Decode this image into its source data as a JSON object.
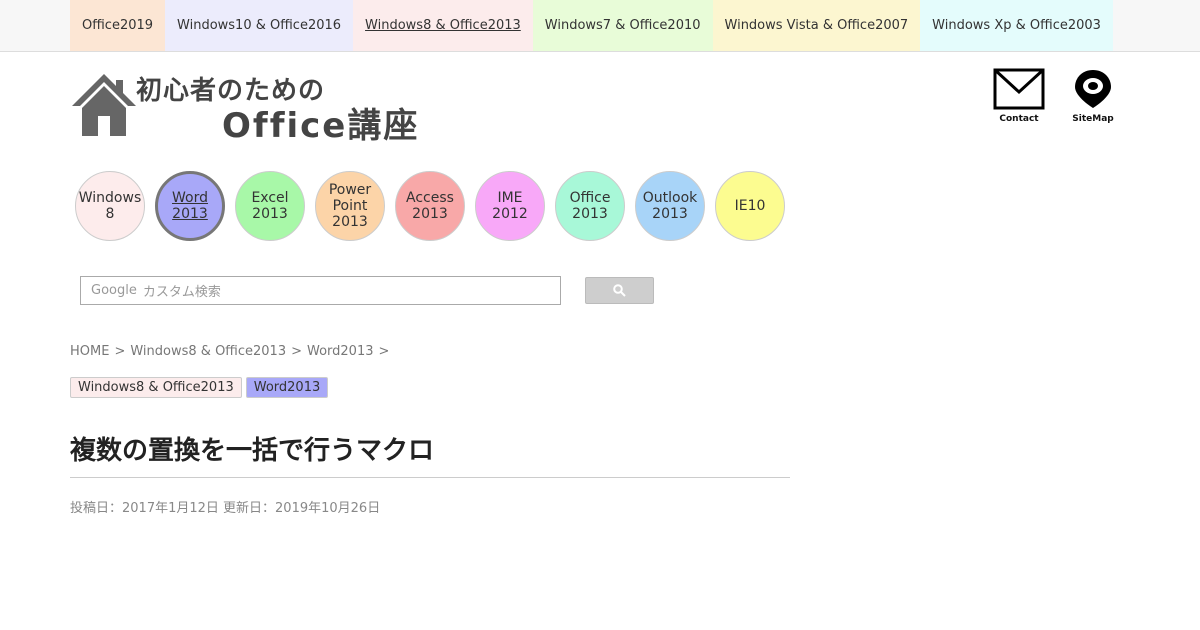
{
  "topnav": {
    "items": [
      {
        "label": "Office2019",
        "color": "#fce6d4",
        "active": false
      },
      {
        "label": "Windows10 & Office2016",
        "color": "#ececfc",
        "active": false
      },
      {
        "label": "Windows8 & Office2013",
        "color": "#fcecec",
        "active": true
      },
      {
        "label": "Windows7 & Office2010",
        "color": "#e8fcd8",
        "active": false
      },
      {
        "label": "Windows Vista & Office2007",
        "color": "#fcf6d0",
        "active": false
      },
      {
        "label": "Windows Xp & Office2003",
        "color": "#e4fcfc",
        "active": false
      }
    ]
  },
  "header": {
    "logo_line1": "初心者のための",
    "logo_line2": "Office講座",
    "contact_label": "Contact",
    "sitemap_label": "SiteMap",
    "logo_icon": "house-icon",
    "contact_icon": "envelope-icon",
    "sitemap_icon": "map-pin-icon"
  },
  "circles": [
    {
      "label": "Windows\n8",
      "color": "#fdecec",
      "active": false
    },
    {
      "label": "Word\n2013",
      "color": "#a8a8f8",
      "active": true
    },
    {
      "label": "Excel\n2013",
      "color": "#a8f8a8",
      "active": false
    },
    {
      "label": "Power\nPoint\n2013",
      "color": "#fcd4a8",
      "active": false
    },
    {
      "label": "Access\n2013",
      "color": "#f8a8a8",
      "active": false
    },
    {
      "label": "IME\n2012",
      "color": "#f8a8f8",
      "active": false
    },
    {
      "label": "Office\n2013",
      "color": "#a8f8d8",
      "active": false
    },
    {
      "label": "Outlook\n2013",
      "color": "#a8d4f8",
      "active": false
    },
    {
      "label": "IE10",
      "color": "#fcfc90",
      "active": false
    }
  ],
  "search": {
    "brand": "Google",
    "placeholder": "カスタム検索",
    "button_icon": "search-icon"
  },
  "breadcrumb": [
    {
      "label": "HOME"
    },
    {
      "label": "Windows8 & Office2013"
    },
    {
      "label": "Word2013"
    }
  ],
  "breadcrumb_separator": ">",
  "tags": [
    {
      "label": "Windows8 & Office2013",
      "color": "#fcecec"
    },
    {
      "label": "Word2013",
      "color": "#a8a8f8"
    }
  ],
  "article": {
    "title": "複数の置換を一括で行うマクロ",
    "dates": "投稿日：2017年1月12日 更新日：2019年10月26日"
  }
}
